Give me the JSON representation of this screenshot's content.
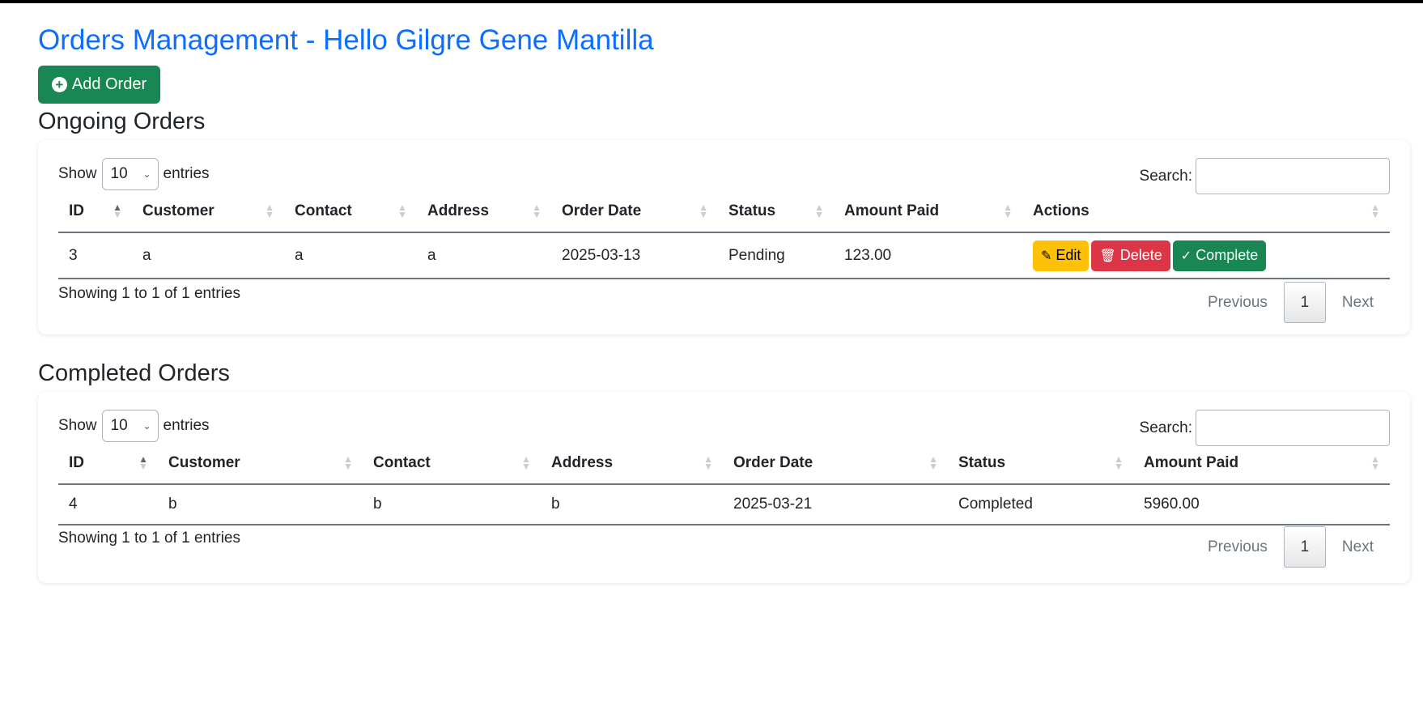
{
  "header": {
    "title": "Orders Management - Hello Gilgre Gene Mantilla",
    "add_button": "Add Order"
  },
  "ongoing": {
    "title": "Ongoing Orders",
    "show_label": "Show",
    "page_length": "10",
    "entries_label": "entries",
    "search_label": "Search:",
    "search_value": "",
    "columns": [
      "ID",
      "Customer",
      "Contact",
      "Address",
      "Order Date",
      "Status",
      "Amount Paid",
      "Actions"
    ],
    "rows": [
      {
        "id": "3",
        "customer": "a",
        "contact": "a",
        "address": "a",
        "order_date": "2025-03-13",
        "status": "Pending",
        "amount": "123.00"
      }
    ],
    "actions": {
      "edit": "Edit",
      "delete": "Delete",
      "complete": "Complete"
    },
    "info": "Showing 1 to 1 of 1 entries",
    "pager": {
      "previous": "Previous",
      "current": "1",
      "next": "Next"
    }
  },
  "completed": {
    "title": "Completed Orders",
    "show_label": "Show",
    "page_length": "10",
    "entries_label": "entries",
    "search_label": "Search:",
    "search_value": "",
    "columns": [
      "ID",
      "Customer",
      "Contact",
      "Address",
      "Order Date",
      "Status",
      "Amount Paid"
    ],
    "rows": [
      {
        "id": "4",
        "customer": "b",
        "contact": "b",
        "address": "b",
        "order_date": "2025-03-21",
        "status": "Completed",
        "amount": "5960.00"
      }
    ],
    "info": "Showing 1 to 1 of 1 entries",
    "pager": {
      "previous": "Previous",
      "current": "1",
      "next": "Next"
    }
  },
  "colors": {
    "primary": "#0d6efd",
    "success": "#198754",
    "warning": "#ffc107",
    "danger": "#dc3545"
  },
  "icons": {
    "add": "plus-circle-icon",
    "edit": "pencil-square-icon",
    "delete": "trash-icon",
    "complete": "check-circle-icon",
    "sort": "sort-arrows-icon",
    "select": "chevron-down-icon"
  }
}
